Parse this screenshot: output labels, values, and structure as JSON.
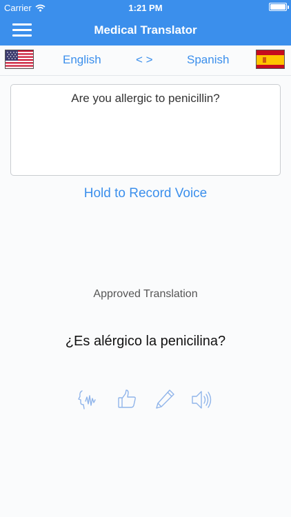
{
  "status_bar": {
    "carrier": "Carrier",
    "time": "1:21 PM"
  },
  "nav": {
    "title": "Medical Translator",
    "menu_icon": "hamburger-menu-icon"
  },
  "languages": {
    "source_label": "English",
    "swap_label": "< >",
    "target_label": "Spanish",
    "source_flag": "us-flag-icon",
    "target_flag": "spain-flag-icon"
  },
  "input": {
    "text": "Are you allergic to penicillin?"
  },
  "record": {
    "label": "Hold to Record Voice"
  },
  "result": {
    "heading": "Approved Translation",
    "text": "¿Es alérgico la penicilina?"
  },
  "actions": [
    {
      "icon": "speak-face-icon"
    },
    {
      "icon": "thumbs-up-icon"
    },
    {
      "icon": "pencil-icon"
    },
    {
      "icon": "speaker-icon"
    }
  ],
  "colors": {
    "accent": "#3b8fec",
    "background": "#fafbfc",
    "icon_tint": "#8fb4ea"
  }
}
